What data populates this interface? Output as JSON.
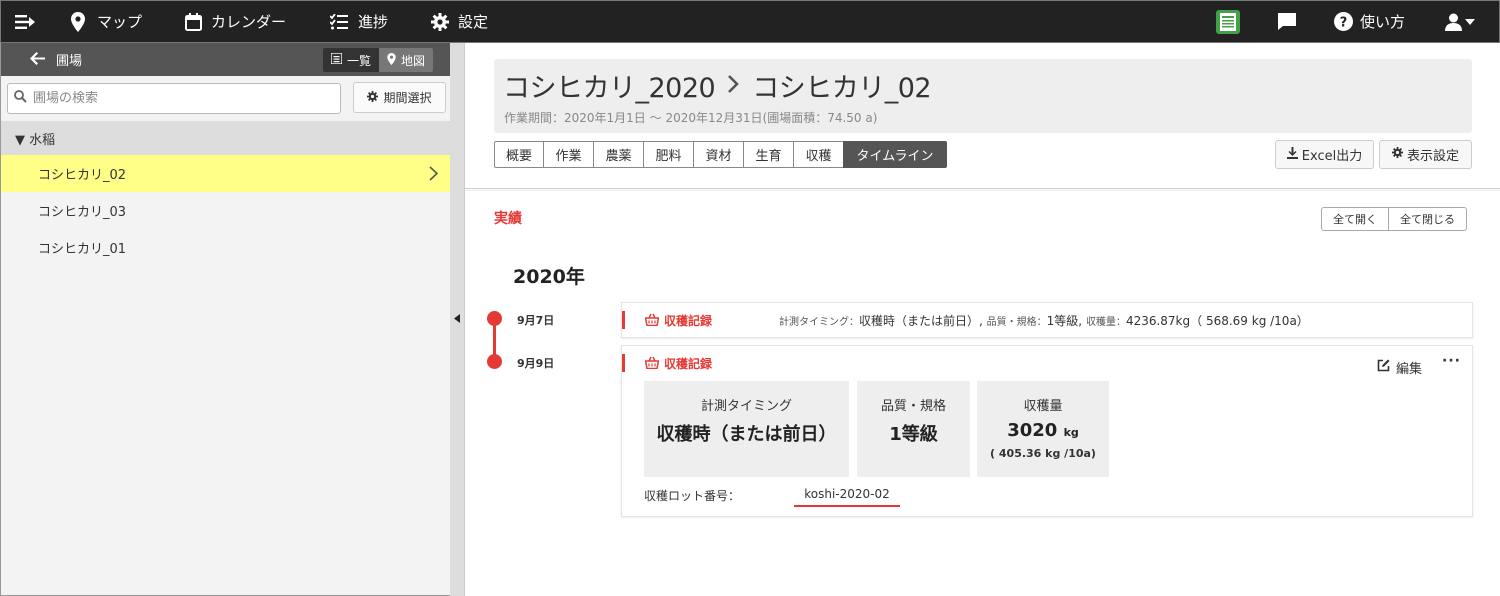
{
  "nav": {
    "items": [
      {
        "icon": "map-pin-icon",
        "label": "マップ"
      },
      {
        "icon": "calendar-icon",
        "label": "カレンダー"
      },
      {
        "icon": "progress-list-icon",
        "label": "進捗"
      },
      {
        "icon": "gear-icon",
        "label": "設定"
      }
    ],
    "help_label": "使い方"
  },
  "sidebar": {
    "title": "圃場",
    "view_list": "一覧",
    "view_map": "地図",
    "search_placeholder": "圃場の検索",
    "period_button": "期間選択",
    "category": "▼ 水稲",
    "fields": [
      {
        "name": "コシヒカリ_02",
        "selected": true
      },
      {
        "name": "コシヒカリ_03",
        "selected": false
      },
      {
        "name": "コシヒカリ_01",
        "selected": false
      }
    ]
  },
  "header": {
    "breadcrumb_parent": "コシヒカリ_2020",
    "breadcrumb_current": "コシヒカリ_02",
    "period": "作業期間：2020年1月1日 ～ 2020年12月31日(圃場面積：74.50 a)"
  },
  "tabs": [
    "概要",
    "作業",
    "農薬",
    "肥料",
    "資材",
    "生育",
    "収穫",
    "タイムライン"
  ],
  "active_tab": "タイムライン",
  "toolbar": {
    "excel_label": "Excel出力",
    "display_settings_label": "表示設定"
  },
  "timeline": {
    "section_title": "実績",
    "expand_all": "全て開く",
    "collapse_all": "全て閉じる",
    "year": "2020年",
    "entries": [
      {
        "date": "9月7日",
        "type": "収穫記録",
        "summary": {
          "timing_label": "計測タイミング：",
          "timing_value": "収穫時（または前日）,",
          "quality_label": "品質・規格：",
          "quality_value": "1等級,",
          "amount_label": "収穫量：",
          "amount_value": "4236.87kg（ 568.69 kg /10a）"
        }
      },
      {
        "date": "9月9日",
        "type": "収穫記録",
        "edit_label": "編集",
        "more_label": "···",
        "stats": [
          {
            "label": "計測タイミング",
            "value": "収穫時（または前日）"
          },
          {
            "label": "品質・規格",
            "value": "1等級"
          },
          {
            "label": "収穫量",
            "value": "3020",
            "unit": "kg",
            "sub": "( 405.36 kg /10a)"
          }
        ],
        "lot_label": "収穫ロット番号：",
        "lot_value": "koshi-2020-02"
      }
    ]
  },
  "colors": {
    "accent": "#e53935",
    "nav_bg": "#222222",
    "selected_row": "#ffff88"
  }
}
